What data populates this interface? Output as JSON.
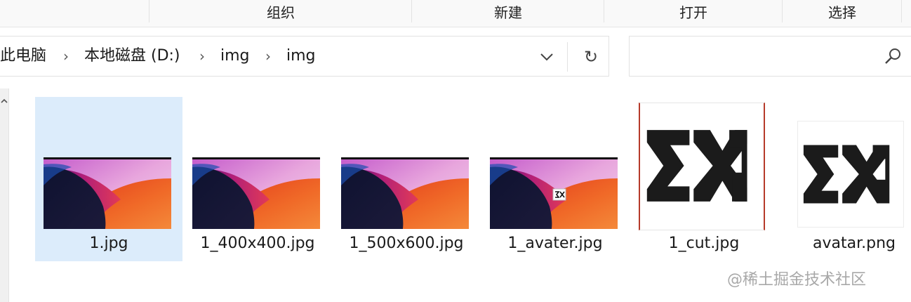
{
  "ribbon": {
    "items": [
      "组织",
      "新建",
      "打开",
      "选择"
    ]
  },
  "address": {
    "breadcrumbs": [
      "此电脑",
      "本地磁盘 (D:)",
      "img",
      "img"
    ],
    "separator": "›",
    "refresh_glyph": "↻"
  },
  "search": {
    "placeholder": ""
  },
  "files": [
    {
      "name": "1.jpg",
      "kind": "wallpaper",
      "selected": true
    },
    {
      "name": "1_400x400.jpg",
      "kind": "wallpaper",
      "selected": false
    },
    {
      "name": "1_500x600.jpg",
      "kind": "wallpaper",
      "selected": false
    },
    {
      "name": "1_avater.jpg",
      "kind": "wallpaper-with-badge",
      "selected": false
    },
    {
      "name": "1_cut.jpg",
      "kind": "logo",
      "selected": false
    },
    {
      "name": "avatar.png",
      "kind": "logo",
      "selected": false
    }
  ],
  "watermark": "@稀土掘金技术社区",
  "colors": {
    "selection": "#dcecfb",
    "ribbon_bg": "#f9f9f9",
    "logo_black": "#1b1b1b",
    "thumb_border_red": "#b63a2a"
  },
  "icons": [
    "chevron-down-icon",
    "refresh-icon",
    "search-icon",
    "scroll-up-icon"
  ]
}
